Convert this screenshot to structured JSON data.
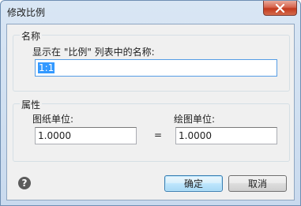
{
  "window": {
    "title": "修改比例"
  },
  "name_group": {
    "legend": "名称",
    "field_label": "显示在 \"比例\" 列表中的名称:",
    "name_value": "1:1"
  },
  "props_group": {
    "legend": "属性",
    "paper_units_label": "图纸单位:",
    "paper_units_value": "1.0000",
    "equals": "=",
    "drawing_units_label": "绘图单位:",
    "drawing_units_value": "1.0000"
  },
  "buttons": {
    "ok": "确定",
    "cancel": "取消",
    "help_glyph": "?"
  },
  "icons": {
    "close": "close-icon",
    "help": "help-icon"
  }
}
